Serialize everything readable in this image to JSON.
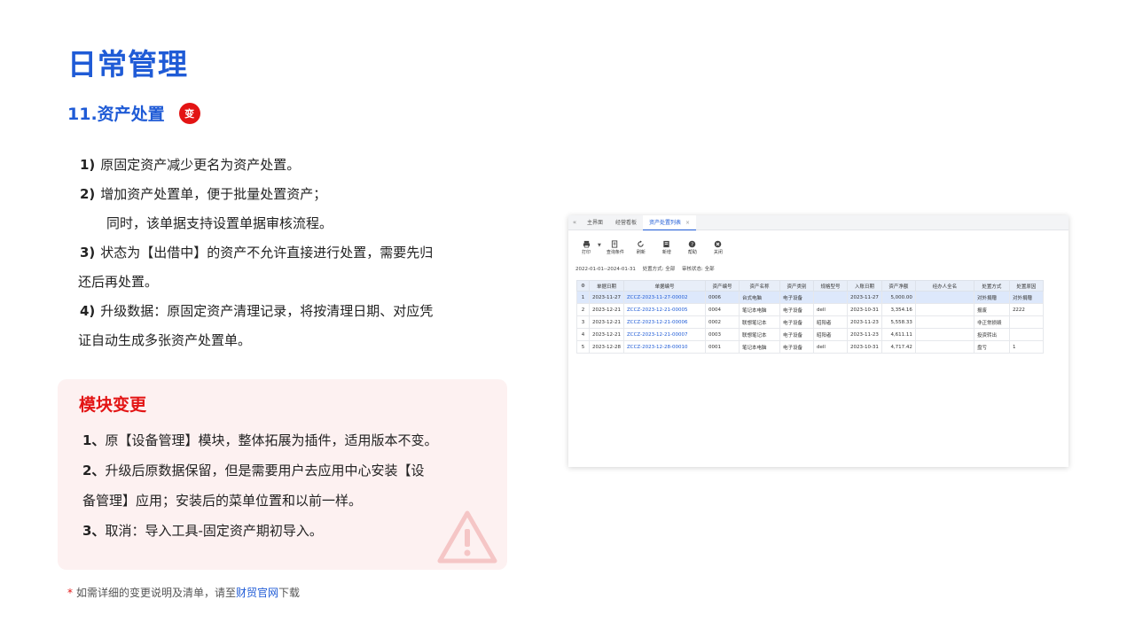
{
  "page": {
    "title": "日常管理",
    "section_title": "11.资产处置",
    "change_badge": "变"
  },
  "points": [
    {
      "num": "1)",
      "text": "原固定资产减少更名为资产处置。"
    },
    {
      "num": "2)",
      "text": "增加资产处置单，便于批量处置资产；"
    },
    {
      "num": "",
      "text": "同时，该单据支持设置单据审核流程。"
    },
    {
      "num": "3)",
      "text": "状态为【出借中】的资产不允许直接进行处置，需要先归"
    },
    {
      "num": "",
      "text": "还后再处置。"
    },
    {
      "num": "4)",
      "text": "升级数据：原固定资产清理记录，将按清理日期、对应凭"
    },
    {
      "num": "",
      "text": "证自动生成多张资产处置单。"
    }
  ],
  "module": {
    "title": "模块变更",
    "items": [
      {
        "num": "1、",
        "text": "原【设备管理】模块，整体拓展为插件，适用版本不变。"
      },
      {
        "num": "2、",
        "text": "升级后原数据保留，但是需要用户去应用中心安装【设"
      },
      {
        "num": "",
        "text": "备管理】应用；安装后的菜单位置和以前一样。"
      },
      {
        "num": "3、",
        "text": "取消：导入工具-固定资产期初导入。"
      }
    ]
  },
  "footnote": {
    "star": "*",
    "text_before": "如需详细的变更说明及清单，请至",
    "link": "财贸官网",
    "text_after": "下载"
  },
  "app": {
    "tabs": [
      {
        "label": "主界面",
        "active": false
      },
      {
        "label": "经营看板",
        "active": false
      },
      {
        "label": "资产处置列表",
        "active": true,
        "closable": "×"
      }
    ],
    "collapse_icon": "«",
    "toolbar": [
      {
        "icon": "print-icon",
        "label": "打印"
      },
      {
        "icon": "filter-icon",
        "label": "查询条件"
      },
      {
        "icon": "refresh-icon",
        "label": "刷新"
      },
      {
        "icon": "add-doc-icon",
        "label": "新增"
      },
      {
        "icon": "help-icon",
        "label": "帮助"
      },
      {
        "icon": "close-icon",
        "label": "关闭"
      }
    ],
    "filter": {
      "date_range": "2022-01-01--2024-01-31",
      "method_label": "处置方式: 全部",
      "status_label": "审核状态: 全部"
    },
    "columns": [
      "单据日期",
      "单据编号",
      "资产编号",
      "资产名称",
      "资产类别",
      "规格型号",
      "入账日期",
      "资产净额",
      "经办人全名",
      "处置方式",
      "处置原因"
    ],
    "rows": [
      {
        "idx": "1",
        "date": "2023-11-27",
        "code": "ZCCZ-2023-11-27-00002",
        "asset_no": "0006",
        "name": "台式电脑",
        "category": "电子设备",
        "spec": "",
        "entry_date": "2023-11-27",
        "net": "5,000.00",
        "handler": "",
        "method": "对外捐赠",
        "reason": "对外捐赠"
      },
      {
        "idx": "2",
        "date": "2023-12-21",
        "code": "ZCCZ-2023-12-21-00005",
        "asset_no": "0004",
        "name": "笔记本电脑",
        "category": "电子设备",
        "spec": "dell",
        "entry_date": "2023-10-31",
        "net": "3,354.16",
        "handler": "",
        "method": "报废",
        "reason": "2222"
      },
      {
        "idx": "3",
        "date": "2023-12-21",
        "code": "ZCCZ-2023-12-21-00006",
        "asset_no": "0002",
        "name": "联想笔记本",
        "category": "电子设备",
        "spec": "昭阳者",
        "entry_date": "2023-11-23",
        "net": "5,558.33",
        "handler": "",
        "method": "非正常损毁",
        "reason": ""
      },
      {
        "idx": "4",
        "date": "2023-12-21",
        "code": "ZCCZ-2023-12-21-00007",
        "asset_no": "0003",
        "name": "联想笔记本",
        "category": "电子设备",
        "spec": "昭阳者",
        "entry_date": "2023-11-23",
        "net": "4,611.11",
        "handler": "",
        "method": "投资转出",
        "reason": ""
      },
      {
        "idx": "5",
        "date": "2023-12-28",
        "code": "ZCCZ-2023-12-28-00010",
        "asset_no": "0001",
        "name": "笔记本电脑",
        "category": "电子设备",
        "spec": "dell",
        "entry_date": "2023-10-31",
        "net": "4,717.42",
        "handler": "",
        "method": "盘亏",
        "reason": "1"
      }
    ]
  },
  "colors": {
    "brand_blue": "#1f5bd6",
    "alert_red": "#e31414",
    "module_bg": "#fdf1f1"
  }
}
